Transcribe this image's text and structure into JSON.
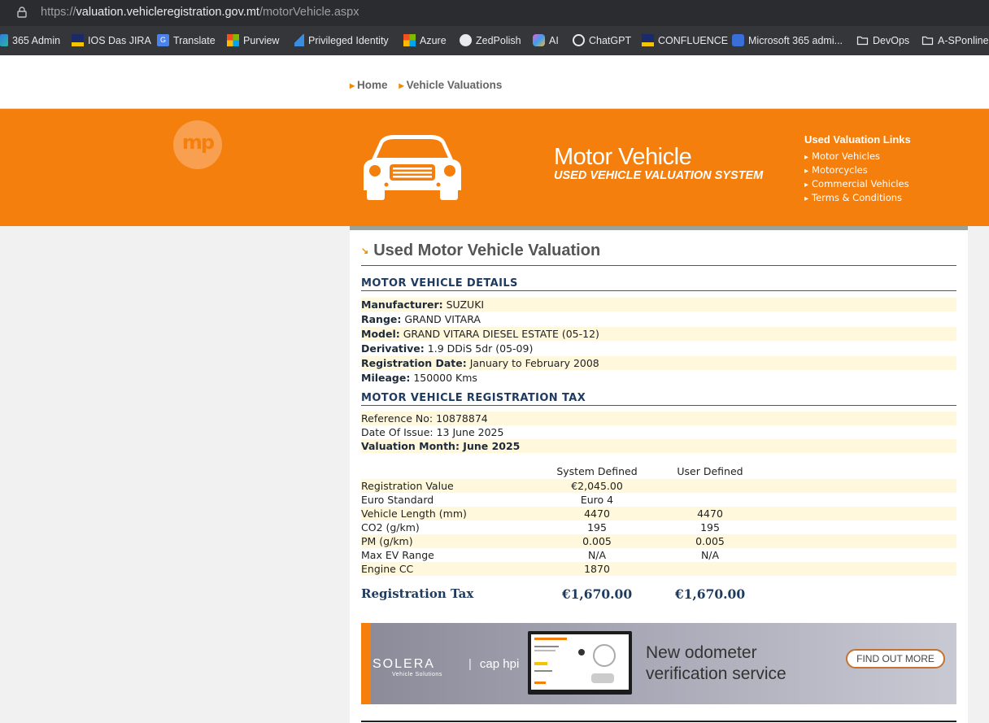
{
  "browser": {
    "url_scheme": "https://",
    "url_host": "valuation.vehicleregistration.gov.mt",
    "url_path": "/motorVehicle.aspx",
    "bookmarks": [
      {
        "label": "365 Admin",
        "icon": "m365-icon"
      },
      {
        "label": "IOS Das JIRA",
        "icon": "jira-icon"
      },
      {
        "label": "Translate",
        "icon": "translate-icon"
      },
      {
        "label": "Purview",
        "icon": "microsoft-icon"
      },
      {
        "label": "Privileged Identity",
        "icon": "azure-icon"
      },
      {
        "label": "Azure",
        "icon": "microsoft-icon"
      },
      {
        "label": "ZedPolish",
        "icon": "github-icon"
      },
      {
        "label": "AI",
        "icon": "copilot-icon"
      },
      {
        "label": "ChatGPT",
        "icon": "chatgpt-icon"
      },
      {
        "label": "CONFLUENCE",
        "icon": "confluence-icon"
      },
      {
        "label": "Microsoft 365 admi...",
        "icon": "m365-admin-icon"
      },
      {
        "label": "DevOps",
        "icon": "folder-icon"
      },
      {
        "label": "A-SPonline",
        "icon": "folder-icon"
      }
    ]
  },
  "breadcrumb": {
    "home": "Home",
    "current": "Vehicle Valuations"
  },
  "banner": {
    "logo": "mp",
    "title": "Motor Vehicle",
    "subtitle": "USED VEHICLE VALUATION SYSTEM",
    "links_title": "Used Valuation Links",
    "links": [
      "Motor Vehicles",
      "Motorcycles",
      "Commercial Vehicles",
      "Terms & Conditions"
    ]
  },
  "page": {
    "title": "Used Motor Vehicle Valuation",
    "details_heading": "MOTOR VEHICLE DETAILS",
    "details": [
      {
        "label": "Manufacturer:",
        "value": "SUZUKI"
      },
      {
        "label": "Range:",
        "value": "GRAND VITARA"
      },
      {
        "label": "Model:",
        "value": "GRAND VITARA DIESEL ESTATE (05-12)"
      },
      {
        "label": "Derivative:",
        "value": "1.9 DDiS 5dr (05-09)"
      },
      {
        "label": "Registration Date:",
        "value": "January to February 2008"
      },
      {
        "label": "Mileage:",
        "value": "150000 Kms"
      }
    ],
    "tax_heading": "MOTOR VEHICLE REGISTRATION TAX",
    "reference": "Reference No: 10878874",
    "date_of_issue": "Date Of Issue: 13 June 2025",
    "valuation_month": "Valuation Month: June 2025",
    "table_headers": {
      "system": "System Defined",
      "user": "User Defined"
    },
    "table_rows": [
      {
        "label": "Registration Value",
        "system": "€2,045.00",
        "user": ""
      },
      {
        "label": "Euro Standard",
        "system": "Euro 4",
        "user": ""
      },
      {
        "label": "Vehicle Length (mm)",
        "system": "4470",
        "user": "4470"
      },
      {
        "label": "CO2 (g/km)",
        "system": "195",
        "user": "195"
      },
      {
        "label": "PM (g/km)",
        "system": "0.005",
        "user": "0.005"
      },
      {
        "label": "Max EV Range",
        "system": "N/A",
        "user": "N/A"
      },
      {
        "label": "Engine CC",
        "system": "1870",
        "user": ""
      }
    ],
    "tax_label": "Registration Tax",
    "tax_system": "€1,670.00",
    "tax_user": "€1,670.00"
  },
  "ad": {
    "brand": "SOLERA",
    "brand_sub": "Vehicle Solutions",
    "partner": "cap hpi",
    "headline_line1": "New odometer",
    "headline_line2": "verification service",
    "cta": "FIND OUT MORE"
  },
  "colors": {
    "brand_orange": "#f47f0c",
    "heading_navy": "#1e3a5f",
    "row_shade": "#fff8dc"
  }
}
